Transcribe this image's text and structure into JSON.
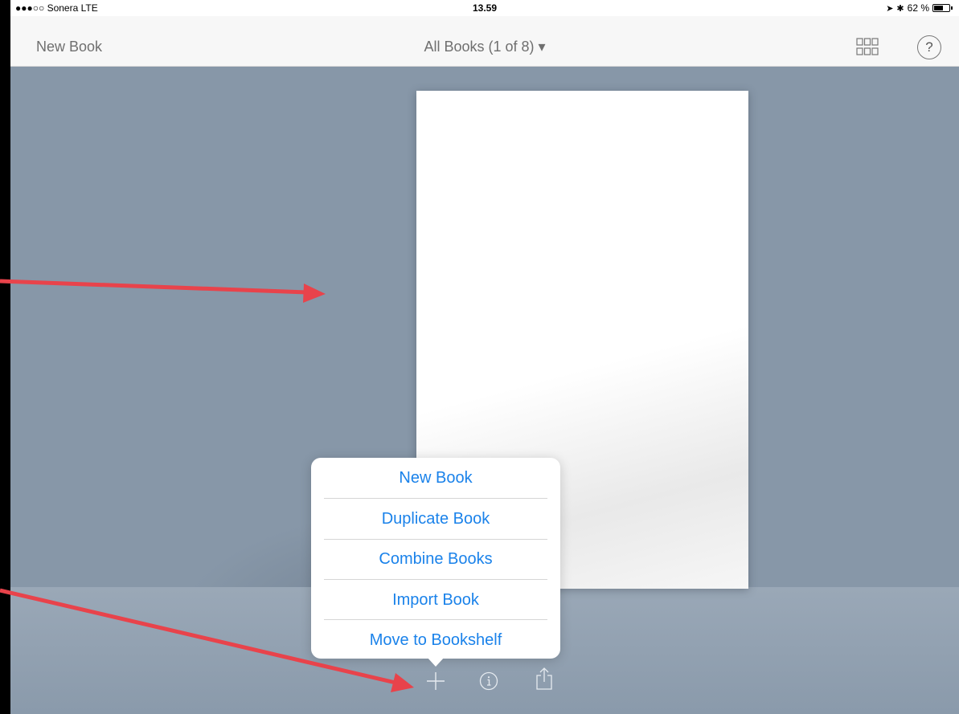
{
  "status_bar": {
    "carrier": "●●●○○ Sonera  LTE",
    "time": "13.59",
    "battery": "62 %",
    "battery_level": 0.62
  },
  "nav_bar": {
    "left_button": "New Book",
    "title": "All Books (1 of 8) ▾",
    "right_icons": [
      "grid-view-icon",
      "help-icon"
    ],
    "help_glyph": "?"
  },
  "popover_menu": {
    "items": [
      "New Book",
      "Duplicate Book",
      "Combine Books",
      "Import Book",
      "Move to Bookshelf"
    ]
  },
  "toolbar": {
    "icons": [
      "plus-icon",
      "info-icon",
      "share-icon"
    ]
  },
  "colors": {
    "background": "#8797a8",
    "accent": "#1a82ea",
    "annotation_arrow": "#e8434b"
  }
}
